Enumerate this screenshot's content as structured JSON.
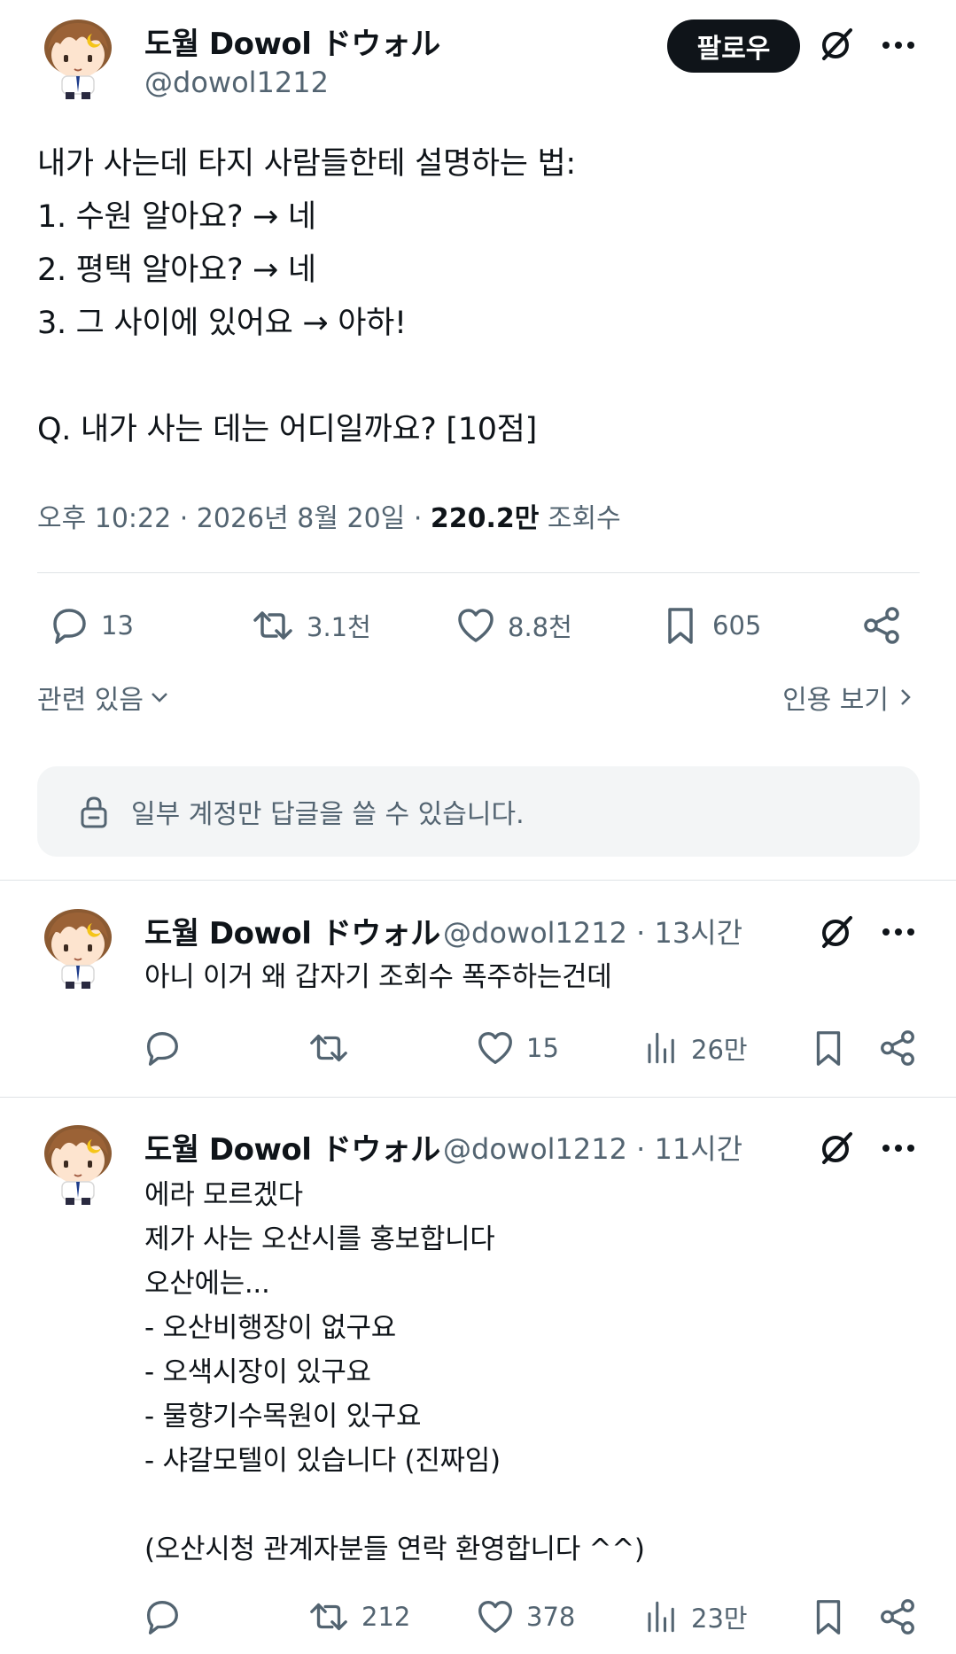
{
  "post": {
    "author_name": "도월 Dowol ドウォル",
    "author_handle": "@dowol1212",
    "follow_label": "팔로우",
    "text": "내가 사는데 타지 사람들한테 설명하는 법:\n1. 수원 알아요? → 네\n2. 평택 알아요? → 네\n3. 그 사이에 있어요 → 아하!\n\nQ. 내가 사는 데는 어디일까요? [10점]",
    "time": "오후 10:22 · 2026년 8월 20일 · ",
    "views_count": "220.2만",
    "views_label": " 조회수",
    "stats": {
      "replies": "13",
      "reposts": "3.1천",
      "likes": "8.8천",
      "bookmarks": "605"
    },
    "related_label": "관련 있음",
    "quotes_label": "인용 보기",
    "reply_restriction": "일부 계정만 답글을 쓸 수 있습니다."
  },
  "replies": [
    {
      "author_name": "도월 Dowol ドウォル",
      "handle_time": "@dowol1212 · 13시간",
      "text": "아니 이거 왜 갑자기 조회수 폭주하는건데",
      "replies": "",
      "reposts": "",
      "likes": "15",
      "views": "26만"
    },
    {
      "author_name": "도월 Dowol ドウォル",
      "handle_time": "@dowol1212 · 11시간",
      "text": "에라 모르겠다\n제가 사는 오산시를 홍보합니다\n오산에는...\n- 오산비행장이 없구요\n- 오색시장이 있구요\n- 물향기수목원이 있구요\n- 샤갈모텔이 있습니다 (진짜임)\n\n(오산시청 관계자분들 연락 환영합니다 ^^)",
      "replies": "",
      "reposts": "212",
      "likes": "378",
      "views": "23만"
    }
  ],
  "colors": {
    "text": "#0f1419",
    "secondary": "#536471",
    "divider": "#dfe3e6",
    "notice_bg": "#f3f5f6"
  },
  "icons": [
    "grok-icon",
    "more-icon",
    "reply-icon",
    "repost-icon",
    "like-icon",
    "bookmark-icon",
    "share-icon",
    "views-icon",
    "lock-icon",
    "chevron-down-icon",
    "chevron-right-icon"
  ]
}
